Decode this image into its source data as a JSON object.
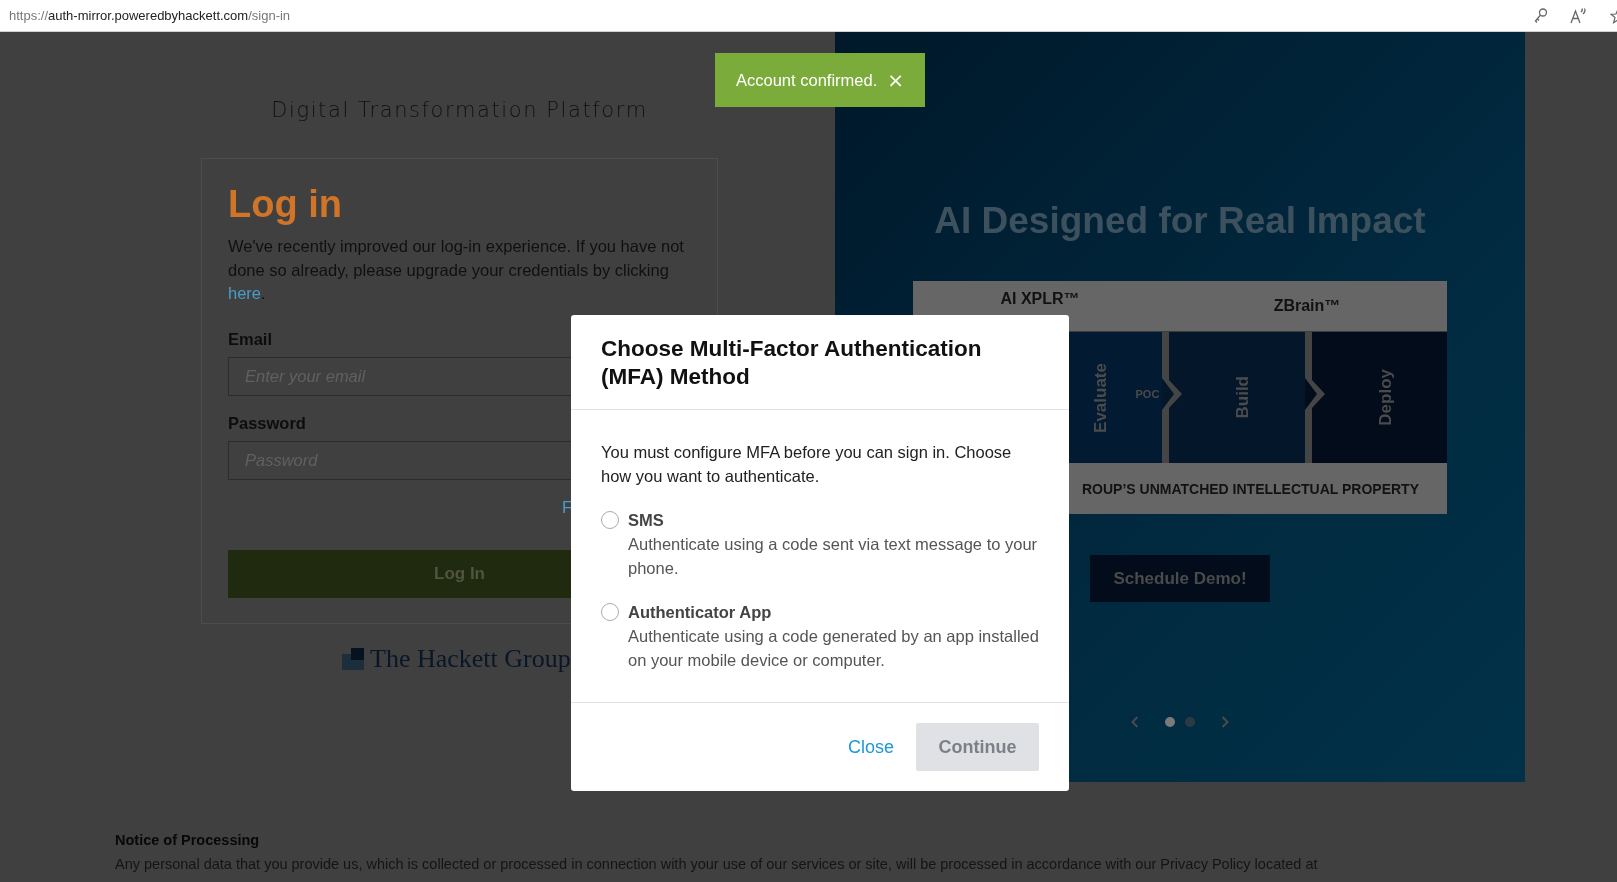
{
  "browser": {
    "url_scheme": "https://",
    "url_host": "auth-mirror.poweredbyhackett.com",
    "url_path": "/sign-in"
  },
  "toast": {
    "message": "Account confirmed.",
    "close": "×"
  },
  "login": {
    "platform_title": "Digital Transformation Platform",
    "title": "Log in",
    "notice": "We've recently improved our log-in experience. If you have not done so already, please upgrade your credentials by clicking",
    "notice_link": "here",
    "notice_tail": ".",
    "email": {
      "label": "Email",
      "placeholder": "Enter your email"
    },
    "password": {
      "label": "Password",
      "placeholder": "Password"
    },
    "forgot_link": "F",
    "button": "Log In",
    "logo": "The Hackett Group"
  },
  "promo": {
    "title": "AI Designed for Real Impact",
    "diagram": {
      "top_labels": [
        "AI XPLR™",
        "ZBrain™"
      ],
      "stages": [
        {
          "label": "Evaluate"
        },
        {
          "label": "Build"
        },
        {
          "label": "Deploy"
        }
      ],
      "poc": "POC",
      "bottom": "ROUP’S UNMATCHED INTELLECTUAL PROPERTY"
    },
    "button": "Schedule Demo!",
    "carousel": {
      "dots": [
        {
          "selected": true
        },
        {
          "selected": false
        }
      ]
    }
  },
  "notice": {
    "title": "Notice of Processing",
    "text": "Any personal data that you provide us, which is collected or processed in connection with your use of our services or site, will be processed in accordance with our Privacy Policy located at"
  },
  "modal": {
    "title": "Choose Multi-Factor Authentication (MFA) Method",
    "intro": "You must configure MFA before you can sign in. Choose how you want to authenticate.",
    "options": [
      {
        "label": "SMS",
        "description": "Authenticate using a code sent via text message to your phone.",
        "selected": false
      },
      {
        "label": "Authenticator App",
        "description": "Authenticate using a code generated by an app installed on your mobile device or computer.",
        "selected": false
      }
    ],
    "close": "Close",
    "continue": {
      "label": "Continue",
      "disabled": true
    }
  }
}
